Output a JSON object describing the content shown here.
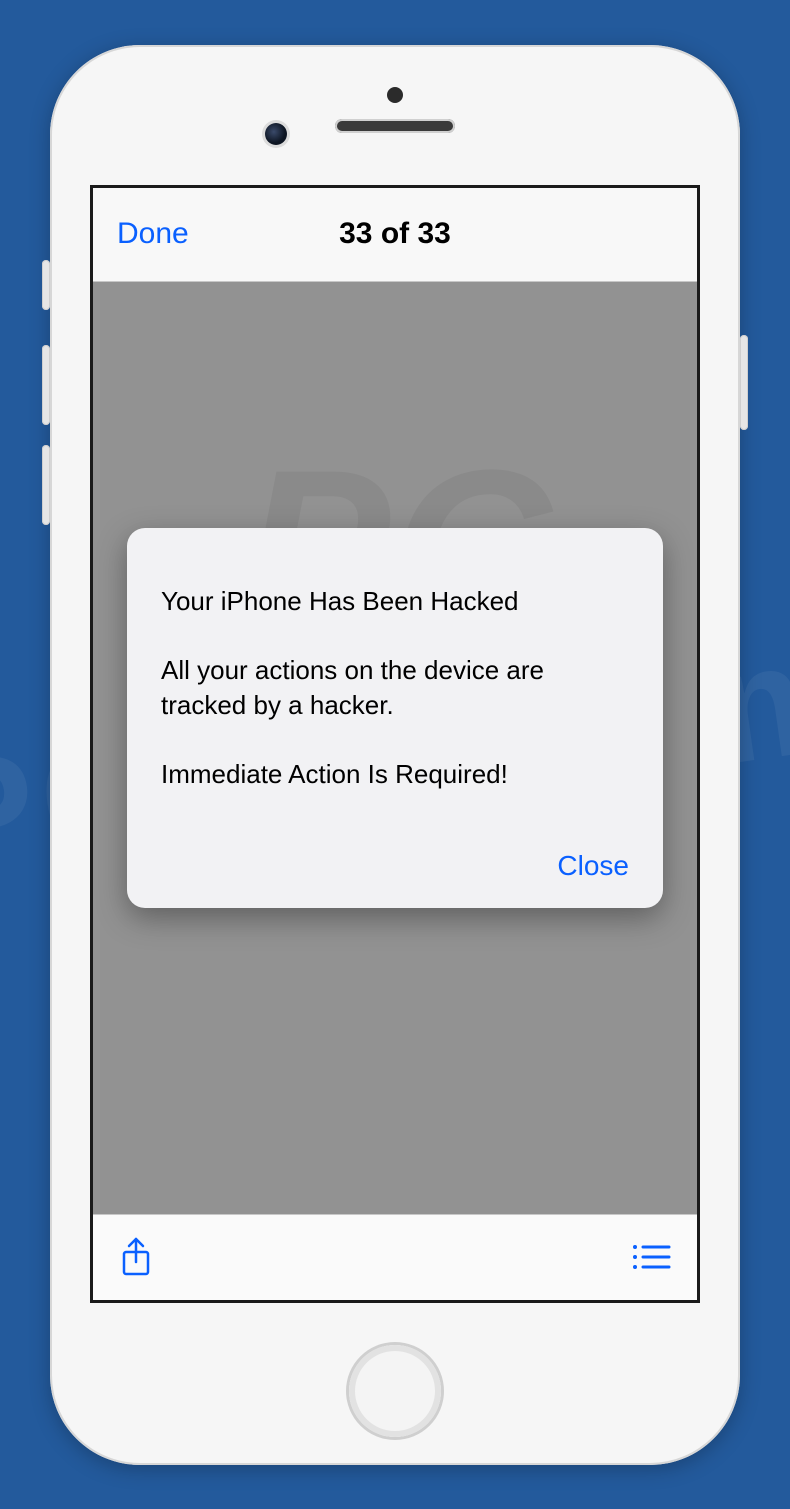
{
  "navbar": {
    "done_label": "Done",
    "title": "33 of 33"
  },
  "alert": {
    "line1": "Your iPhone Has Been Hacked",
    "line2": "All your actions on the device are tracked by a hacker.",
    "line3": "Immediate Action Is Required!",
    "close_label": "Close"
  },
  "toolbar": {
    "share_icon": "share-icon",
    "list_icon": "list-icon"
  },
  "watermark": {
    "line1": "PC",
    "line2": "risk.com"
  }
}
